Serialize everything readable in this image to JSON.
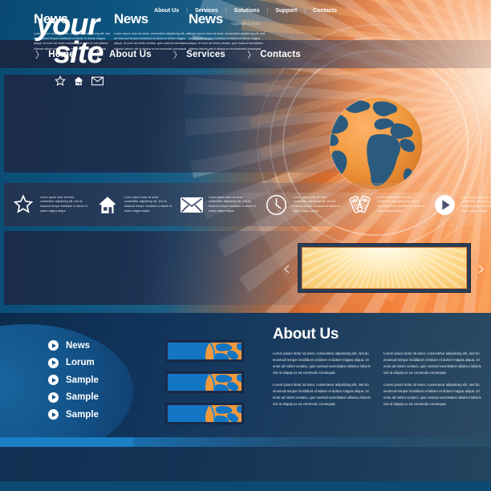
{
  "site": {
    "logo_line1": "your",
    "logo_line2": "site",
    "logo_icons": [
      "star-icon",
      "home-icon",
      "mail-icon"
    ]
  },
  "nav": {
    "chevron": "〉",
    "items": [
      {
        "label": "Home"
      },
      {
        "label": "About Us"
      },
      {
        "label": "Services"
      },
      {
        "label": "Contacts"
      }
    ]
  },
  "hero": {
    "globe_icon": "globe-icon",
    "globe_land_color": "#2a5b7e",
    "globe_ocean_color": "#f0993d"
  },
  "features": {
    "lorem": "Lorem ipsum dolor sit amet, consectetur adipisicing elit, sed do eiusmod tempor incididunt ut labore et dolore magna aliqua.",
    "items": [
      {
        "icon": "star-icon"
      },
      {
        "icon": "home-icon"
      },
      {
        "icon": "mail-icon"
      },
      {
        "icon": "clock-icon"
      },
      {
        "icon": "phones-icon"
      },
      {
        "icon": "play-icon"
      }
    ]
  },
  "news": {
    "columns": [
      {
        "title": "News",
        "body": "Lorem ipsum dolor sit amet, consectetur adipisicing elit, sed do eiusmod tempor incididunt ut labore et dolore magna aliqua. Ut enim ad minim veniam, quis nostrud exercitation ullamco laboris nisi ut aliquip ex ea commodo consequat."
      },
      {
        "title": "News",
        "body": "Lorem ipsum dolor sit amet, consectetur adipisicing elit, sed do eiusmod tempor incididunt ut labore et dolore magna aliqua. Ut enim ad minim veniam, quis nostrud exercitation ullamco laboris nisi ut aliquip ex ea commodo consequat."
      },
      {
        "title": "News",
        "body": "Lorem ipsum dolor sit amet, consectetur adipisicing elit, sed do eiusmod tempor incididunt ut labore et dolore magna aliqua. Ut enim ad minim veniam, quis nostrud exercitation ullamco laboris nisi ut aliquip ex ea commodo consequat."
      }
    ],
    "slider": {
      "prev_arrow": "‹",
      "next_arrow": "›",
      "frame_color": "#2c3c54",
      "accent_color": "#e8903f"
    }
  },
  "sidebar": {
    "items": [
      {
        "label": "News"
      },
      {
        "label": "Lorum"
      },
      {
        "label": "Sample"
      },
      {
        "label": "Sample"
      },
      {
        "label": "Sample"
      }
    ]
  },
  "thumbnails": [
    {
      "name": "globe-thumbnail-1"
    },
    {
      "name": "globe-thumbnail-2"
    },
    {
      "name": "globe-thumbnail-3"
    }
  ],
  "about": {
    "title": "About Us",
    "columns": [
      {
        "paragraphs": [
          "Lorem ipsum dolor sit amet, consectetur adipisicing elit, sed do eiusmod tempor incididunt ut labore et dolore magna aliqua. Ut enim ad minim veniam, quis nostrud exercitation ullamco laboris nisi ut aliquip ex ea commodo consequat.",
          "Lorem ipsum dolor sit amet, consectetur adipisicing elit, sed do eiusmod tempor incididunt ut labore et dolore magna aliqua. Ut enim ad minim veniam, quis nostrud exercitation ullamco laboris nisi ut aliquip ex ea commodo consequat."
        ]
      },
      {
        "paragraphs": [
          "Lorem ipsum dolor sit amet, consectetur adipisicing elit, sed do eiusmod tempor incididunt ut labore et dolore magna aliqua. Ut enim ad minim veniam, quis nostrud exercitation ullamco laboris nisi ut aliquip ex ea commodo consequat.",
          "Lorem ipsum dolor sit amet, consectetur adipisicing elit, sed do eiusmod tempor incididunt ut labore et dolore magna aliqua. Ut enim ad minim veniam, quis nostrud exercitation ullamco laboris nisi ut aliquip ex ea commodo consequat."
        ]
      }
    ]
  },
  "footer": {
    "separator": "|",
    "links": [
      {
        "label": "About Us"
      },
      {
        "label": "Services"
      },
      {
        "label": "Solutions"
      },
      {
        "label": "Support"
      },
      {
        "label": "Contacts"
      }
    ],
    "copyright": "Copyright © 2010"
  },
  "colors": {
    "deep_blue": "#0a4a72",
    "navy_panel": "#1b2a48",
    "orange": "#f4823c",
    "accent_blue": "#1a7fc4"
  }
}
